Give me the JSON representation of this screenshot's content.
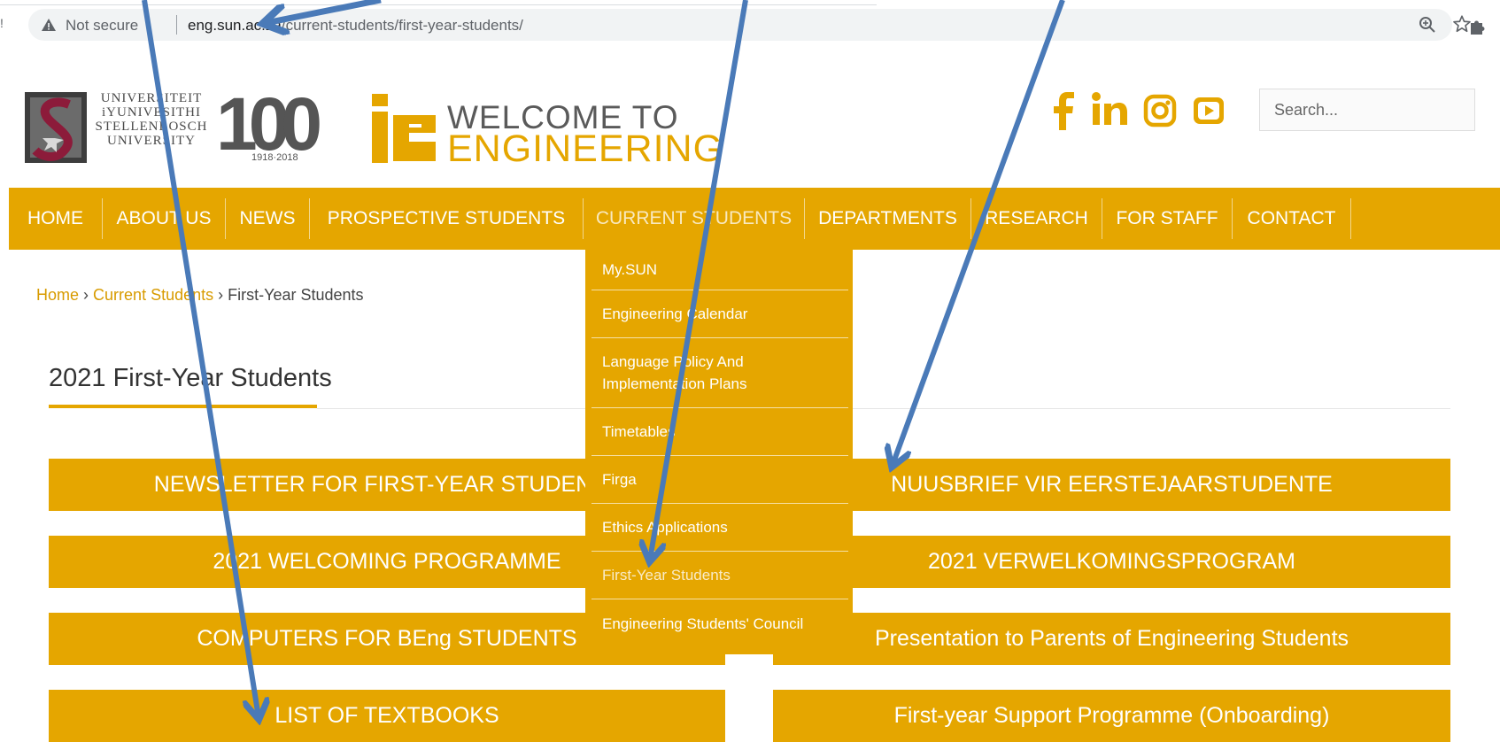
{
  "browser": {
    "tab_fragment": "!",
    "security_label": "Not secure",
    "url_host": "eng.sun.ac.za",
    "url_path": "/current-students/first-year-students/"
  },
  "header": {
    "university_name_lines": [
      "UNIVERSITEIT",
      "iYUNIVESITHI",
      "STELLENBOSCH",
      "UNIVERSITY"
    ],
    "centenary": "100",
    "centenary_years": "1918·2018",
    "welcome": "WELCOME TO",
    "faculty": "ENGINEERING",
    "social_icons": [
      "facebook-icon",
      "linkedin-icon",
      "instagram-icon",
      "youtube-icon"
    ],
    "search_placeholder": "Search..."
  },
  "nav": {
    "items": [
      "HOME",
      "ABOUT US",
      "NEWS",
      "PROSPECTIVE STUDENTS",
      "CURRENT STUDENTS",
      "DEPARTMENTS",
      "RESEARCH",
      "FOR STAFF",
      "CONTACT"
    ],
    "active": "CURRENT STUDENTS"
  },
  "dropdown": {
    "items": [
      "My.SUN",
      "Engineering Calendar",
      "Language Policy And Implementation Plans",
      "Timetables",
      "Firga",
      "Ethics Applications",
      "First-Year Students",
      "Engineering Students' Council"
    ],
    "active": "First-Year Students"
  },
  "breadcrumb": {
    "home": "Home",
    "sep": "›",
    "current_students": "Current Students",
    "current": "First-Year Students"
  },
  "page": {
    "title": "2021 First-Year Students",
    "buttons_left": [
      "NEWSLETTER FOR FIRST-YEAR STUDENTS",
      "2021 WELCOMING PROGRAMME",
      "COMPUTERS FOR BEng STUDENTS",
      "LIST OF TEXTBOOKS"
    ],
    "buttons_right": [
      "NUUSBRIEF VIR EERSTEJAARSTUDENTE",
      "2021 VERWELKOMINGSPROGRAM",
      "Presentation to Parents of Engineering Students",
      "First-year Support Programme (Onboarding)"
    ]
  },
  "colors": {
    "accent": "#e5a600",
    "annotation_arrow": "#4a7ab8"
  }
}
